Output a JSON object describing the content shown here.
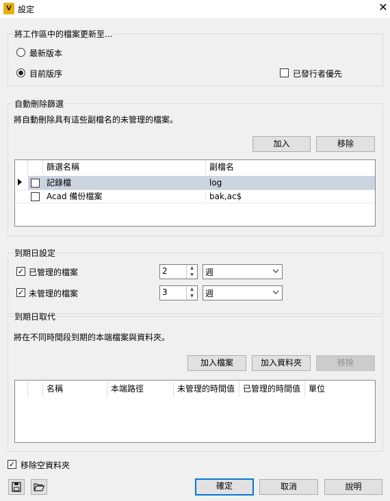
{
  "window": {
    "title": "設定",
    "app_icon_letter": "V"
  },
  "update_group": {
    "title": "將工作區中的檔案更新至...",
    "radio_latest": "最新版本",
    "radio_current": "目前版序",
    "released_priority": "已發行者優先"
  },
  "auto_delete": {
    "title": "自動刪除篩選",
    "description": "將自動刪除具有這些副檔名的未管理的檔案。",
    "add_button": "加入",
    "remove_button": "移除",
    "columns": [
      "篩選名稱",
      "副檔名"
    ],
    "rows": [
      {
        "name": "記錄檔",
        "ext": "log",
        "checked": false,
        "selected": true
      },
      {
        "name": "Acad 備份檔案",
        "ext": "bak,ac$",
        "checked": false,
        "selected": false
      }
    ]
  },
  "expiration": {
    "title": "到期日設定",
    "managed_label": "已管理的檔案",
    "managed_value": "2",
    "managed_unit": "週",
    "unmanaged_label": "未管理的檔案",
    "unmanaged_value": "3",
    "unmanaged_unit": "週"
  },
  "override": {
    "title": "到期日取代",
    "description": "將在不同時間段到期的本端檔案與資料夾。",
    "add_file_button": "加入檔案",
    "add_folder_button": "加入資料夾",
    "remove_button": "移除",
    "columns": [
      "名稱",
      "本端路徑",
      "未管理的時間值",
      "已管理的時間值",
      "單位"
    ]
  },
  "remove_empty_folders": "移除空資料夾",
  "footer": {
    "ok": "確定",
    "cancel": "取消",
    "help": "說明"
  },
  "icons": {
    "save": "save-icon",
    "open": "folder-open-icon"
  }
}
